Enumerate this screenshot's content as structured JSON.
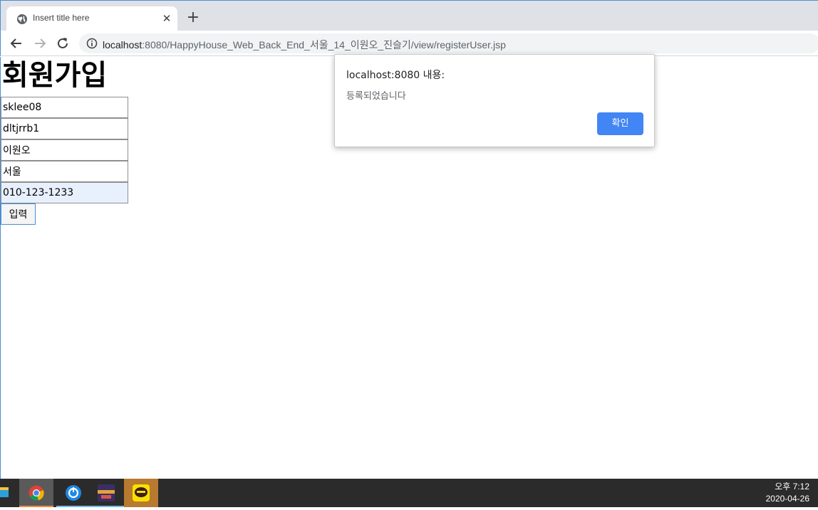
{
  "browser": {
    "tab_title": "Insert title here",
    "tab_close": "✕",
    "new_tab": "+",
    "url_host": "localhost",
    "url_rest": ":8080/HappyHouse_Web_Back_End_서울_14_이원오_진슬기/view/registerUser.jsp"
  },
  "page": {
    "title": "회원가입",
    "fields": [
      {
        "value": "sklee08"
      },
      {
        "value": "dltjrrb1"
      },
      {
        "value": "이원오"
      },
      {
        "value": "서울"
      },
      {
        "value": "010-123-1233"
      }
    ],
    "submit_label": "입력"
  },
  "dialog": {
    "origin": "localhost:8080 내용:",
    "message": "등록되었습니다",
    "ok_label": "확인"
  },
  "taskbar": {
    "time": "오후 7:12",
    "date": "2020-04-26"
  },
  "colors": {
    "accent": "#4285f4",
    "autofill": "#e8f0fe",
    "taskbar": "#2b2b2b"
  }
}
